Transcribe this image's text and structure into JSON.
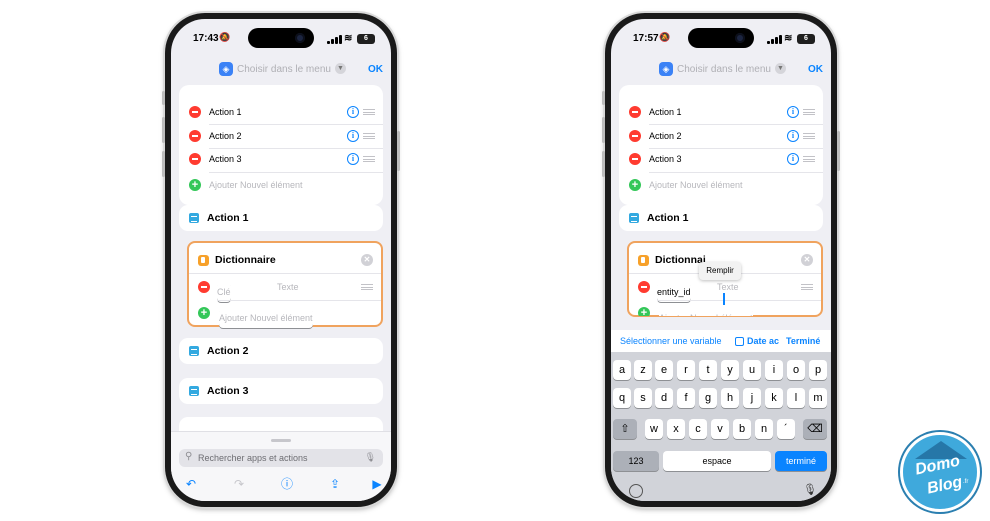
{
  "left_phone": {
    "status": {
      "time": "17:43",
      "battery": "6"
    },
    "topbar": {
      "title": "Choisir dans le menu",
      "ok": "OK"
    },
    "menu_items": [
      "Action 1",
      "Action 2",
      "Action 3"
    ],
    "add_item": "Ajouter Nouvel élément",
    "action_1": "Action 1",
    "dictionary": {
      "title": "Dictionnaire",
      "key_placeholder": "Clé",
      "value_placeholder": "Texte",
      "add_item": "Ajouter Nouvel élément"
    },
    "action_2": "Action 2",
    "action_3": "Action 3",
    "search_placeholder": "Rechercher apps et actions"
  },
  "right_phone": {
    "status": {
      "time": "17:57",
      "battery": "6"
    },
    "topbar": {
      "title": "Choisir dans le menu",
      "ok": "OK"
    },
    "menu_items": [
      "Action 1",
      "Action 2",
      "Action 3"
    ],
    "add_item": "Ajouter Nouvel élément",
    "action_1": "Action 1",
    "dictionary": {
      "title": "Dictionnai",
      "key_value": "entity_id",
      "value_placeholder": "Texte",
      "add_item": "Ajouter Nouvel élément"
    },
    "tooltip": "Remplir",
    "suggest": {
      "variable": "Sélectionner une variable",
      "date": "Date ac",
      "done": "Terminé"
    },
    "keyboard": {
      "row1": [
        "a",
        "z",
        "e",
        "r",
        "t",
        "y",
        "u",
        "i",
        "o",
        "p"
      ],
      "row2": [
        "q",
        "s",
        "d",
        "f",
        "g",
        "h",
        "j",
        "k",
        "l",
        "m"
      ],
      "row3": [
        "w",
        "x",
        "c",
        "v",
        "b",
        "n",
        "´"
      ],
      "numbers": "123",
      "space": "espace",
      "return": "terminé"
    }
  },
  "logo": {
    "line1": "Domo",
    "line2": "Blog",
    "suffix": ".fr"
  },
  "colors": {
    "accent": "#0a84ff",
    "highlight": "#f0a35e",
    "minus": "#ff3b30",
    "plus": "#34c759",
    "dict_icon": "#f7a12a"
  }
}
